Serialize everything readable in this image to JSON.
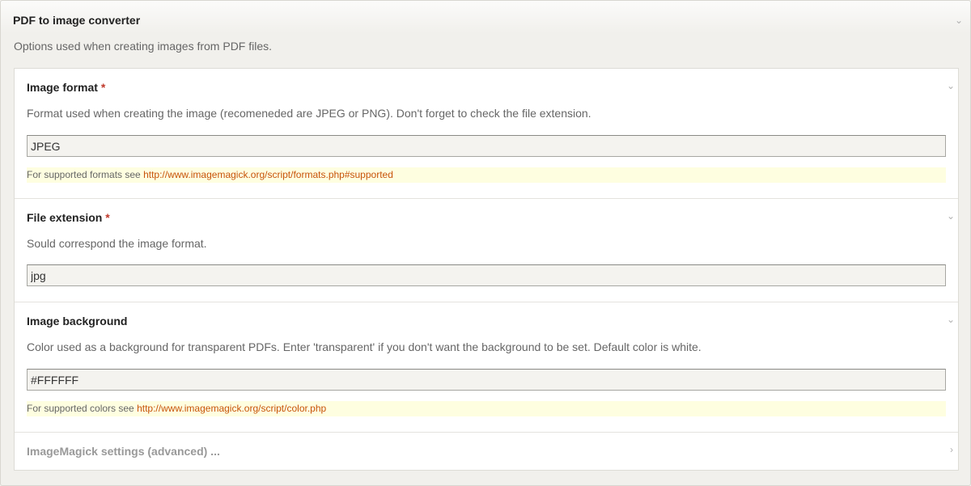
{
  "panel": {
    "title": "PDF to image converter",
    "description": "Options used when creating images from PDF files.",
    "collapse_icon": "chevron-down-icon"
  },
  "fields": [
    {
      "label": "Image format",
      "required_marker": "*",
      "description": "Format used when creating the image (recomeneded are JPEG or PNG). Don't forget to check the file extension.",
      "value": "JPEG",
      "hint_prefix": "For supported formats see ",
      "hint_link": "http://www.imagemagick.org/script/formats.php#supported"
    },
    {
      "label": "File extension",
      "required_marker": "*",
      "description": "Sould correspond the image format.",
      "value": "jpg"
    },
    {
      "label": "Image background",
      "description": "Color used as a background for transparent PDFs. Enter 'transparent' if you don't want the background to be set. Default color is white.",
      "value": "#FFFFFF",
      "hint_prefix": "For supported colors see ",
      "hint_link": "http://www.imagemagick.org/script/color.php"
    }
  ],
  "advanced": {
    "label": "ImageMagick settings (advanced) ...",
    "expand_icon": "chevron-right-icon"
  },
  "colors": {
    "required": "#c0392b",
    "link": "#c8540a",
    "hint_bg": "#fefee0"
  }
}
